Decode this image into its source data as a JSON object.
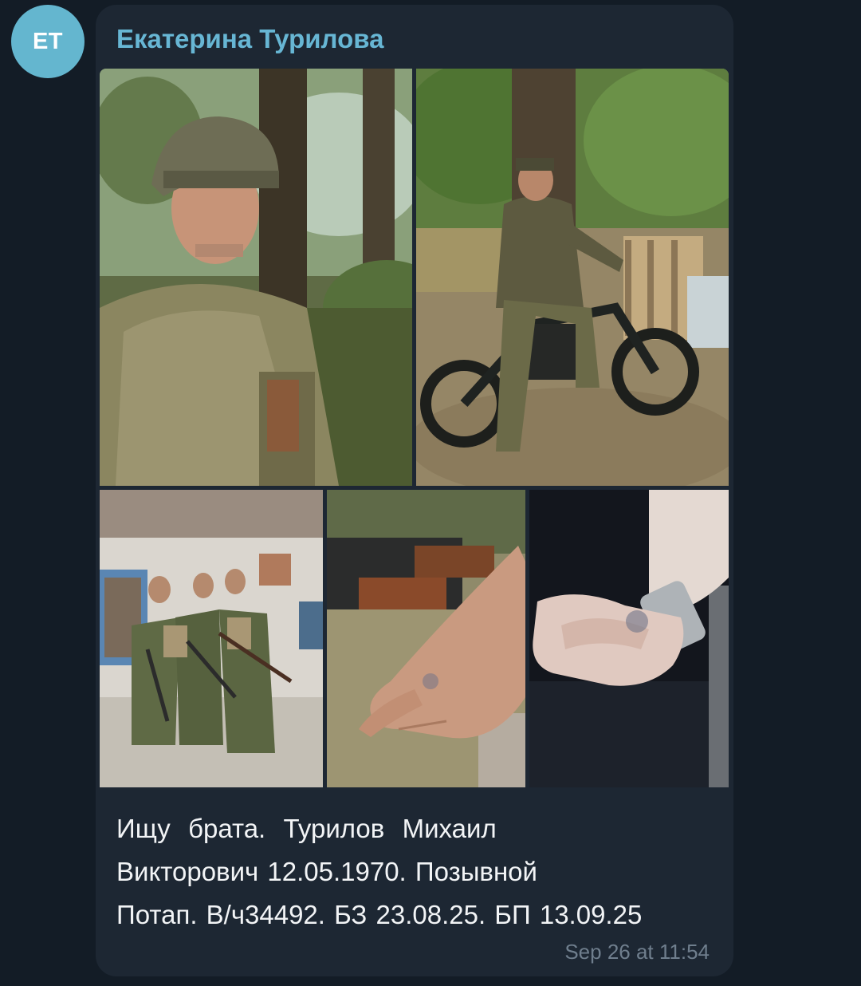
{
  "avatar": {
    "initials": "ET",
    "color": "#64b6cf"
  },
  "message": {
    "sender": "Екатерина Турилова",
    "text": "Ищу  брата.  Турилов  Михаил\nВикторович 12.05.1970. Позывной\nПотап. В/ч34492. БЗ 23.08.25. БП 13.09.25",
    "timestamp": "Sep 26 at 11:54",
    "photos_count": 5
  },
  "colors": {
    "background": "#131c26",
    "bubble": "#1d2733",
    "sender_name": "#67b6d4",
    "text": "#f2f4f6",
    "timestamp": "#6f7e8d"
  }
}
